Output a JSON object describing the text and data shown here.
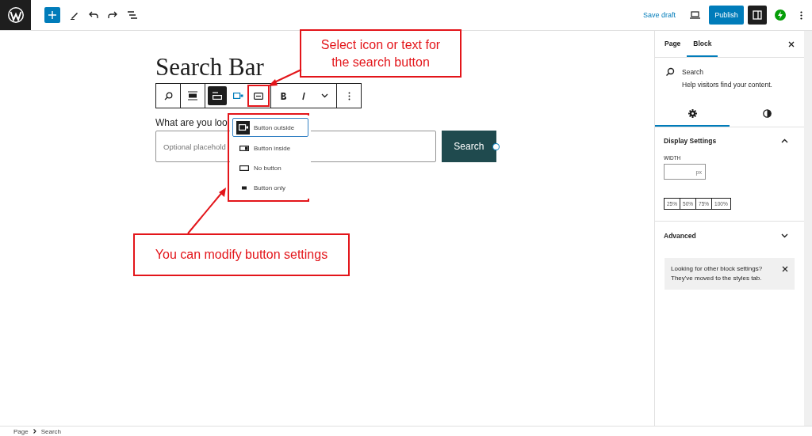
{
  "top_bar": {
    "save_draft": "Save draft",
    "publish": "Publish",
    "settings_toggle": {
      "pressed": true
    }
  },
  "editor": {
    "title": "Search Bar",
    "block_toolbar": [
      {
        "kind": "block-type",
        "pressed": false
      },
      {
        "kind": "align",
        "pressed": false
      },
      {
        "kind": "position",
        "pressed": true
      },
      {
        "kind": "icon-toggle",
        "pressed": true
      },
      {
        "kind": "text-toggle",
        "pressed": false
      },
      {
        "kind": "bold",
        "pressed": false
      },
      {
        "kind": "italic",
        "pressed": false
      },
      {
        "kind": "more",
        "pressed": false
      },
      {
        "kind": "options",
        "pressed": false
      }
    ],
    "position_menu": [
      {
        "label": "Button outside",
        "kind": "outside",
        "selected": true
      },
      {
        "label": "Button inside",
        "kind": "inside",
        "selected": false
      },
      {
        "label": "No button",
        "kind": "none",
        "selected": false
      },
      {
        "label": "Button only",
        "kind": "only",
        "selected": false
      }
    ],
    "search_block": {
      "label": "What are you loo",
      "placeholder": "Optional placehold",
      "button": "Search"
    },
    "annotations": [
      {
        "text": "Select icon or text for the search button"
      },
      {
        "text": "You can modify button settings"
      }
    ]
  },
  "sidebar": {
    "tabs": [
      {
        "label": "Page",
        "selected": false
      },
      {
        "label": "Block",
        "selected": true
      }
    ],
    "block_card": {
      "title": "Search",
      "description": "Help visitors find your content."
    },
    "inspector_tabs": [
      {
        "kind": "settings",
        "selected": true
      },
      {
        "kind": "styles",
        "selected": false
      }
    ],
    "display_settings": {
      "title": "Display Settings",
      "expanded": true,
      "width_label": "WIDTH",
      "unit": "px",
      "presets": [
        "25%",
        "50%",
        "75%",
        "100%"
      ]
    },
    "advanced": {
      "title": "Advanced",
      "expanded": false
    },
    "notice": "Looking for other block settings? They've moved to the styles tab."
  },
  "breadcrumb": [
    "Page",
    "Search"
  ]
}
